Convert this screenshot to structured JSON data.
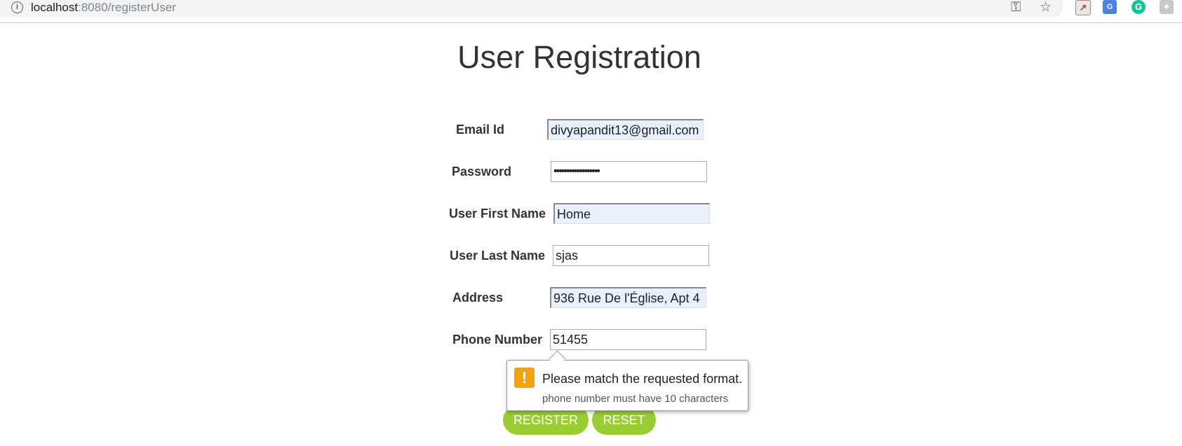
{
  "browser": {
    "url_host": "localhost",
    "url_path": ":8080/registerUser"
  },
  "page": {
    "title": "User Registration"
  },
  "form": {
    "email": {
      "label": "Email Id",
      "value": "divyapandit13@gmail.com"
    },
    "password": {
      "label": "Password",
      "value": "••••••••••••••••••"
    },
    "first_name": {
      "label": "User First Name",
      "value": "Home"
    },
    "last_name": {
      "label": "User Last Name",
      "value": "sjas"
    },
    "address": {
      "label": "Address",
      "value": "936 Rue  De l'Église, Apt 4"
    },
    "phone": {
      "label": "Phone Number",
      "value": "51455"
    }
  },
  "tooltip": {
    "message": "Please match the requested format.",
    "detail": "phone number must have 10 characters"
  },
  "buttons": {
    "register": "REGISTER",
    "reset": "RESET"
  },
  "colors": {
    "button_bg": "#9acd32",
    "autofill_bg": "#e8f0fe",
    "warning": "#f4a20c"
  }
}
